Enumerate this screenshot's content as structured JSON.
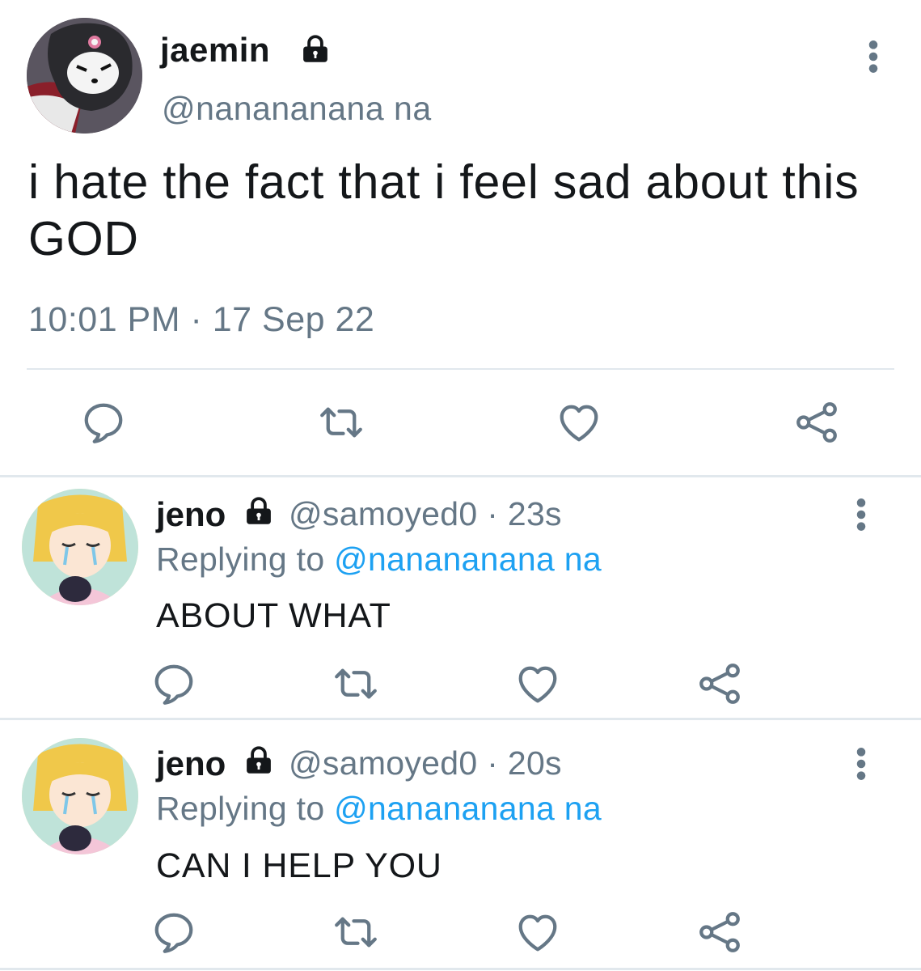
{
  "main_tweet": {
    "display_name": "jaemin",
    "handle": "@nanananana na",
    "text": "i hate the fact that i feel sad about this GOD",
    "timestamp": "10:01 PM · 17 Sep 22",
    "avatar": "kuromi-avatar",
    "actions": [
      "reply-icon",
      "retweet-icon",
      "like-icon",
      "share-icon"
    ]
  },
  "replies": [
    {
      "display_name": "jeno",
      "handle": "@samoyed0",
      "time": "23s",
      "replying_prefix": "Replying to",
      "replying_to": "@nanananana na",
      "text": "ABOUT WHAT",
      "avatar": "sailor-moon-avatar"
    },
    {
      "display_name": "jeno",
      "handle": "@samoyed0",
      "time": "20s",
      "replying_prefix": "Replying to",
      "replying_to": "@nanananana na",
      "text": "CAN I HELP YOU",
      "avatar": "sailor-moon-avatar"
    }
  ],
  "colors": {
    "text": "#14171a",
    "secondary": "#657786",
    "link": "#1da1f2",
    "divider": "#e1e8ed"
  }
}
